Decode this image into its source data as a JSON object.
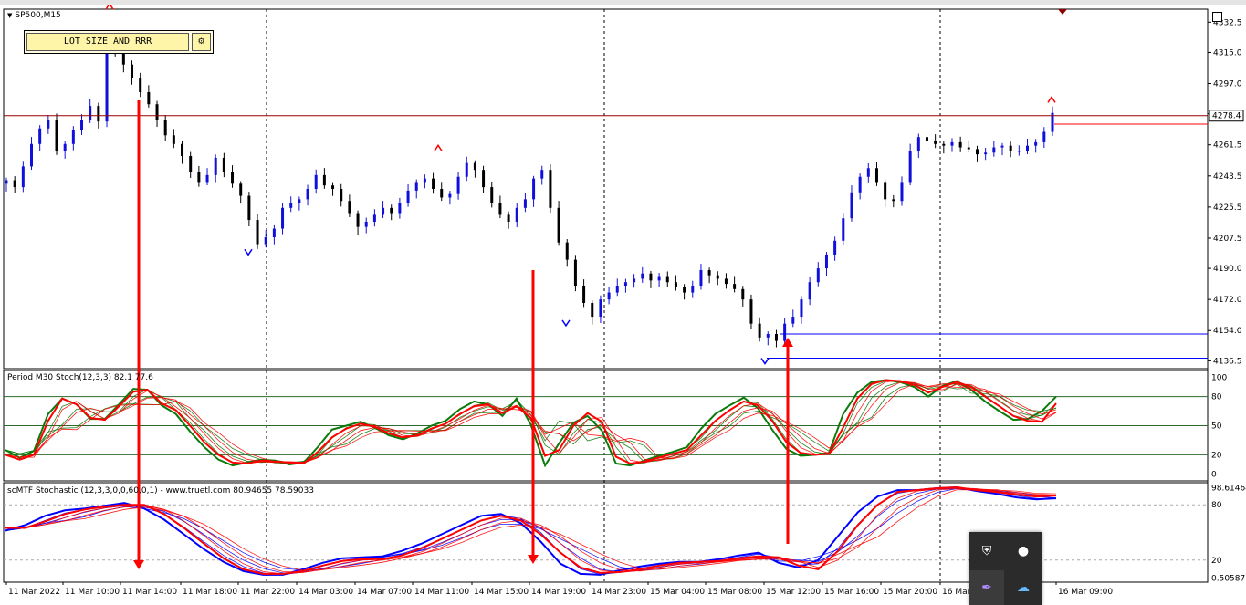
{
  "window": {
    "symbol_timeframe": "SP500,M15"
  },
  "panel": {
    "button_label": "LOT SIZE AND RRR",
    "icon": "settings-icon"
  },
  "colors": {
    "bull": "#1010dd",
    "bear": "#000000",
    "price_line": "#990000",
    "red_arrow": "#ff0000",
    "grid_dash": "#000000",
    "stoch_green": "#0a7a0a",
    "stoch_red": "#ff0000",
    "mtf_blue": "#0000ff"
  },
  "tray": {
    "icons": [
      "shield-check-icon",
      "microphone-icon",
      "pen-icon",
      "cloud-icon"
    ]
  },
  "chart_data": [
    {
      "type": "candlestick",
      "title": "SP500,M15",
      "y_ticks": [
        4332.5,
        4315.0,
        4297.0,
        4279.5,
        4261.5,
        4243.5,
        4225.5,
        4207.5,
        4190.0,
        4172.0,
        4154.0,
        4136.5
      ],
      "y_tick_labels": [
        "4332.5",
        "4315.0",
        "4297.0",
        "4279.5",
        "4261.5",
        "4243.5",
        "4225.5",
        "4207.5",
        "4190.0",
        "4172.0",
        "4154.0",
        "4136.5"
      ],
      "ylim": [
        4133,
        4339
      ],
      "current_price": 4278.4,
      "current_price_label": "4278.4",
      "horizontal_levels": [
        {
          "value": 4278.4,
          "color": "#990000"
        },
        {
          "value": 4288.0,
          "color": "#ff0000"
        },
        {
          "value": 4273.5,
          "color": "#ff0000"
        },
        {
          "value": 4152.0,
          "color": "#0000ff"
        },
        {
          "value": 4138.0,
          "color": "#0000ff"
        }
      ],
      "x_labels": [
        "11 Mar 2022",
        "11 Mar 10:00",
        "11 Mar 14:00",
        "11 Mar 18:00",
        "11 Mar 22:00",
        "14 Mar 03:00",
        "14 Mar 07:00",
        "14 Mar 11:00",
        "14 Mar 15:00",
        "14 Mar 19:00",
        "14 Mar 23:00",
        "15 Mar 04:00",
        "15 Mar 08:00",
        "15 Mar 12:00",
        "15 Mar 16:00",
        "15 Mar 20:00",
        "16 Mar",
        "16 Mar 09:00"
      ],
      "close_path": [
        4241,
        4237,
        4249,
        4262,
        4271,
        4276,
        4258,
        4262,
        4270,
        4276,
        4284,
        4275,
        4318,
        4315,
        4308,
        4300,
        4292,
        4285,
        4276,
        4267,
        4262,
        4255,
        4246,
        4240,
        4244,
        4254,
        4246,
        4239,
        4232,
        4218,
        4204,
        4208,
        4213,
        4225,
        4228,
        4230,
        4236,
        4244,
        4238,
        4236,
        4229,
        4222,
        4214,
        4217,
        4221,
        4225,
        4222,
        4228,
        4235,
        4240,
        4242,
        4236,
        4231,
        4233,
        4243,
        4251,
        4247,
        4237,
        4228,
        4221,
        4217,
        4225,
        4230,
        4242,
        4247,
        4225,
        4205,
        4195,
        4180,
        4170,
        4162,
        4172,
        4176,
        4180,
        4182,
        4184,
        4187,
        4183,
        4185,
        4182,
        4179,
        4176,
        4180,
        4189,
        4186,
        4184,
        4181,
        4178,
        4172,
        4158,
        4150,
        4152,
        4148,
        4158,
        4162,
        4172,
        4182,
        4190,
        4198,
        4206,
        4219,
        4234,
        4243,
        4248,
        4240,
        4230,
        4229,
        4240,
        4258,
        4266,
        4264,
        4262,
        4261,
        4263,
        4260,
        4259,
        4256,
        4257,
        4260,
        4261,
        4258,
        4258,
        4261,
        4263,
        4269,
        4280
      ],
      "blue_arrows_down": [
        [
          272,
          4201
        ],
        [
          620,
          4160
        ],
        [
          838,
          4138
        ]
      ],
      "red_arrows_up": [
        [
          120,
          4340
        ],
        [
          480,
          4258
        ],
        [
          1152,
          4286
        ]
      ]
    },
    {
      "type": "line",
      "title": "Period M30 Stoch(12,3,3) 82.1 77.6",
      "y_tick_labels": [
        "100",
        "80",
        "50",
        "20",
        "0"
      ],
      "y_ticks": [
        100,
        80,
        50,
        20,
        0
      ],
      "ylim": [
        -5,
        105
      ],
      "levels": [
        80,
        50,
        20
      ],
      "series": [
        {
          "color": "#0a7a0a",
          "values": [
            25,
            17,
            24,
            62,
            78,
            72,
            57,
            57,
            72,
            88,
            87,
            71,
            62,
            44,
            28,
            15,
            9,
            12,
            15,
            14,
            10,
            12,
            28,
            46,
            50,
            54,
            48,
            40,
            36,
            42,
            50,
            55,
            67,
            75,
            72,
            60,
            78,
            51,
            9,
            32,
            53,
            60,
            45,
            11,
            9,
            14,
            19,
            23,
            28,
            47,
            62,
            71,
            79,
            68,
            46,
            26,
            19,
            20,
            22,
            62,
            84,
            95,
            97,
            95,
            90,
            80,
            91,
            96,
            87,
            75,
            65,
            56,
            57,
            65,
            80
          ]
        },
        {
          "color": "#ff0000",
          "values": [
            20,
            15,
            20,
            55,
            78,
            72,
            58,
            56,
            70,
            85,
            87,
            73,
            66,
            50,
            33,
            20,
            12,
            11,
            14,
            13,
            12,
            11,
            23,
            38,
            47,
            52,
            49,
            42,
            38,
            40,
            47,
            52,
            62,
            70,
            72,
            63,
            70,
            58,
            19,
            25,
            50,
            63,
            54,
            18,
            11,
            13,
            17,
            21,
            25,
            40,
            55,
            66,
            75,
            71,
            55,
            33,
            22,
            20,
            21,
            48,
            78,
            93,
            97,
            96,
            92,
            84,
            90,
            95,
            90,
            80,
            70,
            60,
            55,
            54,
            73
          ]
        }
      ]
    },
    {
      "type": "line",
      "title": "scMTF Stochastic (12,3,3,0,0,60,0,1) - www.truetl.com 80.94655 78.59033",
      "y_tick_labels": [
        "98.61464",
        "80",
        "20",
        "0.50587"
      ],
      "y_ticks": [
        98.61464,
        80,
        20,
        0.50587
      ],
      "ylim": [
        -2,
        102
      ],
      "levels": [
        80,
        20
      ],
      "series": [
        {
          "color": "#0000ff",
          "values": [
            52,
            58,
            68,
            74,
            76,
            79,
            82,
            76,
            64,
            48,
            32,
            18,
            8,
            4,
            4,
            10,
            17,
            22,
            23,
            24,
            30,
            38,
            48,
            58,
            68,
            70,
            60,
            40,
            16,
            5,
            4,
            9,
            13,
            16,
            18,
            18,
            21,
            25,
            28,
            17,
            12,
            20,
            46,
            72,
            89,
            96,
            96,
            98,
            99,
            95,
            92,
            88,
            86,
            87
          ]
        },
        {
          "color": "#ff0000",
          "values": [
            55,
            55,
            62,
            70,
            75,
            78,
            80,
            80,
            70,
            55,
            38,
            22,
            10,
            5,
            5,
            8,
            14,
            19,
            21,
            21,
            25,
            33,
            43,
            53,
            63,
            68,
            63,
            48,
            28,
            12,
            6,
            7,
            10,
            14,
            17,
            18,
            19,
            22,
            24,
            23,
            14,
            10,
            30,
            58,
            80,
            94,
            96,
            98,
            99,
            96,
            94,
            91,
            89,
            90
          ]
        }
      ]
    }
  ]
}
